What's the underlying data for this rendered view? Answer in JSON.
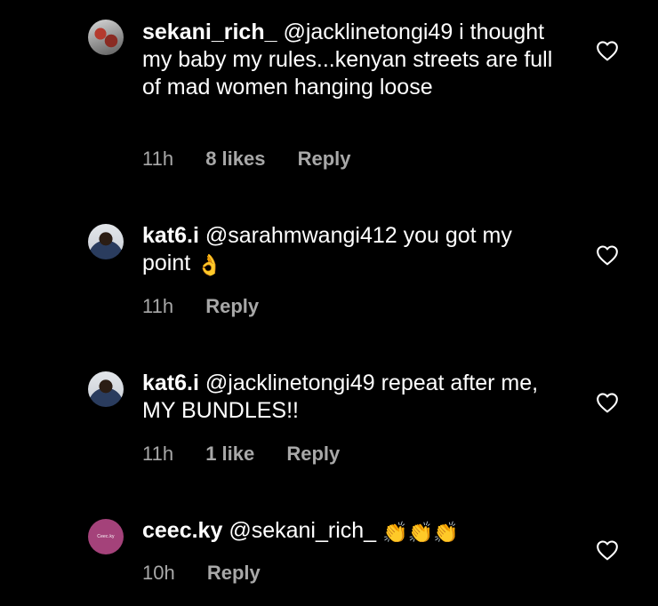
{
  "comments": [
    {
      "username": "sekani_rich_",
      "text": " @jacklinetongi49 i thought my baby my rules...kenyan streets are full of mad women hanging loose",
      "time": "11h",
      "likes": "8 likes",
      "reply": "Reply",
      "avatar_icon": "user-avatar-photo"
    },
    {
      "username": "kat6.i",
      "text": " @sarahmwangi412 you got my point ",
      "emoji": "👌",
      "time": "11h",
      "reply": "Reply",
      "avatar_icon": "user-avatar-photo"
    },
    {
      "username": "kat6.i",
      "text": " @jacklinetongi49 repeat after me, MY BUNDLES!!",
      "time": "11h",
      "likes": "1 like",
      "reply": "Reply",
      "avatar_icon": "user-avatar-photo"
    },
    {
      "username": "ceec.ky",
      "text": " @sekani_rich_ ",
      "emoji": "👏👏👏",
      "time": "10h",
      "reply": "Reply",
      "avatar_label": "Ceec.ky",
      "avatar_color": "#a4427a"
    }
  ],
  "colors": {
    "background": "#000000",
    "text": "#ffffff",
    "meta": "#a8a8a8"
  },
  "icons": {
    "like": "heart-outline-icon"
  }
}
